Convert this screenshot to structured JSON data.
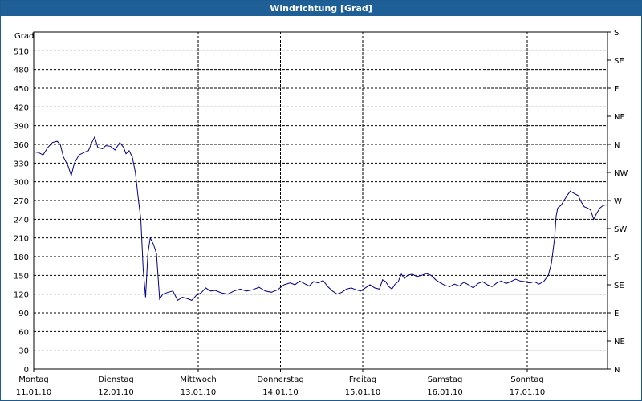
{
  "window": {
    "title": "Windrichtung [Grad]"
  },
  "chart_data": {
    "type": "line",
    "title": "Windrichtung [Grad]",
    "ylabel": "Grad",
    "ylim": [
      0,
      540
    ],
    "y_ticks": [
      0,
      30,
      60,
      90,
      120,
      150,
      180,
      210,
      240,
      270,
      300,
      330,
      360,
      390,
      420,
      450,
      480,
      510
    ],
    "right_axis_labels": [
      "N",
      "NE",
      "E",
      "SE",
      "S",
      "SW",
      "W",
      "NW",
      "N",
      "NE",
      "E",
      "SE",
      "S"
    ],
    "x_ticks": [
      {
        "day": "Montag",
        "date": "11.01.10"
      },
      {
        "day": "Dienstag",
        "date": "12.01.10"
      },
      {
        "day": "Mittwoch",
        "date": "13.01.10"
      },
      {
        "day": "Donnerstag",
        "date": "14.01.10"
      },
      {
        "day": "Freitag",
        "date": "15.01.10"
      },
      {
        "day": "Samstag",
        "date": "16.01.10"
      },
      {
        "day": "Sonntag",
        "date": "17.01.10"
      }
    ],
    "xlim_days": [
      0,
      6.96
    ],
    "grid": true,
    "color": "#00008b",
    "series": [
      {
        "points": [
          [
            0.0,
            348
          ],
          [
            0.06,
            347
          ],
          [
            0.12,
            343
          ],
          [
            0.18,
            355
          ],
          [
            0.24,
            363
          ],
          [
            0.3,
            365
          ],
          [
            0.34,
            360
          ],
          [
            0.38,
            340
          ],
          [
            0.44,
            325
          ],
          [
            0.48,
            310
          ],
          [
            0.52,
            330
          ],
          [
            0.58,
            343
          ],
          [
            0.66,
            348
          ],
          [
            0.7,
            350
          ],
          [
            0.74,
            362
          ],
          [
            0.78,
            372
          ],
          [
            0.82,
            355
          ],
          [
            0.88,
            353
          ],
          [
            0.92,
            358
          ],
          [
            0.98,
            357
          ],
          [
            1.04,
            351
          ],
          [
            1.1,
            363
          ],
          [
            1.15,
            355
          ],
          [
            1.18,
            345
          ],
          [
            1.22,
            350
          ],
          [
            1.26,
            340
          ],
          [
            1.3,
            315
          ],
          [
            1.34,
            270
          ],
          [
            1.37,
            240
          ],
          [
            1.4,
            160
          ],
          [
            1.43,
            115
          ],
          [
            1.46,
            185
          ],
          [
            1.49,
            210
          ],
          [
            1.53,
            200
          ],
          [
            1.57,
            185
          ],
          [
            1.61,
            112
          ],
          [
            1.65,
            120
          ],
          [
            1.72,
            123
          ],
          [
            1.78,
            125
          ],
          [
            1.84,
            110
          ],
          [
            1.9,
            115
          ],
          [
            1.96,
            113
          ],
          [
            2.02,
            110
          ],
          [
            2.08,
            118
          ],
          [
            2.14,
            122
          ],
          [
            2.2,
            130
          ],
          [
            2.26,
            125
          ],
          [
            2.32,
            126
          ],
          [
            2.4,
            122
          ],
          [
            2.48,
            120
          ],
          [
            2.56,
            125
          ],
          [
            2.64,
            128
          ],
          [
            2.72,
            125
          ],
          [
            2.8,
            127
          ],
          [
            2.88,
            131
          ],
          [
            2.96,
            125
          ],
          [
            3.04,
            123
          ],
          [
            3.12,
            127
          ],
          [
            3.2,
            135
          ],
          [
            3.28,
            138
          ],
          [
            3.34,
            135
          ],
          [
            3.4,
            141
          ],
          [
            3.46,
            137
          ],
          [
            3.52,
            133
          ],
          [
            3.58,
            140
          ],
          [
            3.64,
            138
          ],
          [
            3.7,
            142
          ],
          [
            3.76,
            132
          ],
          [
            3.82,
            125
          ],
          [
            3.88,
            120
          ],
          [
            3.94,
            123
          ],
          [
            4.0,
            128
          ],
          [
            4.06,
            130
          ],
          [
            4.12,
            127
          ],
          [
            4.18,
            125
          ],
          [
            4.24,
            130
          ],
          [
            4.3,
            135
          ],
          [
            4.36,
            130
          ],
          [
            4.42,
            128
          ],
          [
            4.46,
            143
          ],
          [
            4.5,
            140
          ],
          [
            4.54,
            132
          ],
          [
            4.58,
            128
          ],
          [
            4.62,
            136
          ],
          [
            4.66,
            140
          ],
          [
            4.7,
            152
          ],
          [
            4.74,
            145
          ],
          [
            4.78,
            150
          ],
          [
            4.84,
            152
          ],
          [
            4.9,
            148
          ],
          [
            4.96,
            150
          ],
          [
            5.02,
            153
          ],
          [
            5.08,
            150
          ],
          [
            5.14,
            143
          ],
          [
            5.2,
            138
          ],
          [
            5.26,
            134
          ],
          [
            5.32,
            132
          ],
          [
            5.38,
            136
          ],
          [
            5.44,
            133
          ],
          [
            5.5,
            139
          ],
          [
            5.56,
            135
          ],
          [
            5.62,
            130
          ],
          [
            5.68,
            137
          ],
          [
            5.74,
            140
          ],
          [
            5.8,
            135
          ],
          [
            5.86,
            132
          ],
          [
            5.92,
            138
          ],
          [
            5.98,
            141
          ],
          [
            6.04,
            137
          ],
          [
            6.1,
            140
          ],
          [
            6.16,
            144
          ],
          [
            6.22,
            141
          ],
          [
            6.28,
            140
          ],
          [
            6.34,
            138
          ],
          [
            6.4,
            140
          ],
          [
            6.46,
            136
          ],
          [
            6.52,
            140
          ],
          [
            6.58,
            150
          ],
          [
            6.62,
            170
          ],
          [
            6.66,
            210
          ],
          [
            6.68,
            245
          ],
          [
            6.7,
            258
          ],
          [
            6.74,
            262
          ],
          [
            6.78,
            270
          ],
          [
            6.82,
            278
          ],
          [
            6.86,
            285
          ],
          [
            6.9,
            282
          ],
          [
            6.96,
            278
          ],
          [
            7.0,
            268
          ],
          [
            7.04,
            260
          ],
          [
            7.08,
            258
          ],
          [
            7.12,
            255
          ],
          [
            7.16,
            240
          ],
          [
            7.2,
            250
          ],
          [
            7.24,
            258
          ],
          [
            7.28,
            262
          ],
          [
            7.32,
            263
          ]
        ]
      }
    ]
  }
}
